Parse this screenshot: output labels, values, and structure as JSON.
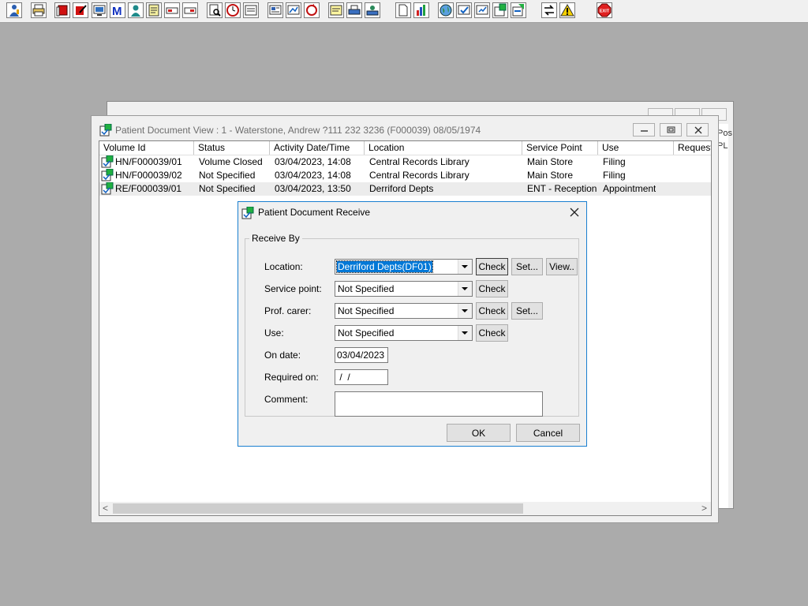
{
  "colors": {
    "desktop": "#ababab",
    "accent": "#0078d7",
    "exit_red": "#e02020"
  },
  "toolbar": {
    "buttons": [
      {
        "name": "user-icon"
      },
      {
        "name": "printer-icon"
      },
      {
        "name": "book-icon"
      },
      {
        "name": "edit-icon"
      },
      {
        "name": "screen-icon"
      },
      {
        "name": "m-icon"
      },
      {
        "name": "person-icon"
      },
      {
        "name": "form-icon"
      },
      {
        "name": "tag-icon"
      },
      {
        "name": "tag-alt-icon"
      },
      {
        "name": "search-doc-icon"
      },
      {
        "name": "clock-icon"
      },
      {
        "name": "panel-icon"
      },
      {
        "name": "report-icon"
      },
      {
        "name": "chart-doc-icon"
      },
      {
        "name": "cycle-icon"
      },
      {
        "name": "note-icon"
      },
      {
        "name": "transfer-icon"
      },
      {
        "name": "transfer-alt-icon"
      },
      {
        "name": "document-icon"
      },
      {
        "name": "bar-chart-icon"
      },
      {
        "name": "globe-icon"
      },
      {
        "name": "doc-check-icon"
      },
      {
        "name": "doc-edit-icon"
      },
      {
        "name": "doc-green-icon"
      },
      {
        "name": "doc-green-alt-icon"
      },
      {
        "name": "swap-icon"
      },
      {
        "name": "warning-icon"
      },
      {
        "name": "exit-icon",
        "label": "EXIT"
      }
    ]
  },
  "back_window": {
    "edge_text_top": "Pos",
    "edge_text_second": "PL"
  },
  "main_window": {
    "title": "Patient Document View : 1 - Waterstone, Andrew ?111 232 3236 (F000039) 08/05/1974",
    "columns": [
      "Volume Id",
      "Status",
      "Activity Date/Time",
      "Location",
      "Service Point",
      "Use",
      "Requeste"
    ],
    "rows": [
      {
        "volume_id": "HN/F000039/01",
        "status": "Volume Closed",
        "activity": "03/04/2023, 14:08",
        "location": "Central Records Library",
        "service_point": "Main Store",
        "use": "Filing"
      },
      {
        "volume_id": "HN/F000039/02",
        "status": "Not Specified",
        "activity": "03/04/2023, 14:08",
        "location": "Central Records Library",
        "service_point": "Main Store",
        "use": "Filing"
      },
      {
        "volume_id": "RE/F000039/01",
        "status": "Not Specified",
        "activity": "03/04/2023, 13:50",
        "location": "Derriford Depts",
        "service_point": "ENT - Reception",
        "use": "Appointment"
      }
    ],
    "scroll_left": "<",
    "scroll_right": ">"
  },
  "dialog": {
    "title": "Patient Document Receive",
    "group_label": "Receive By",
    "location": {
      "label": "Location:",
      "value": "Derriford Depts(DF01)"
    },
    "service_point": {
      "label": "Service point:",
      "value": "Not Specified"
    },
    "prof_carer": {
      "label": "Prof. carer:",
      "value": "Not Specified"
    },
    "use": {
      "label": "Use:",
      "value": "Not Specified"
    },
    "on_date": {
      "label": "On date:",
      "value": "03/04/2023"
    },
    "required_on": {
      "label": "Required on:",
      "value": " /  /"
    },
    "comment": {
      "label": "Comment:",
      "value": ""
    },
    "check_label": "Check",
    "set_label": "Set...",
    "view_label": "View..",
    "ok_label": "OK",
    "cancel_label": "Cancel"
  }
}
